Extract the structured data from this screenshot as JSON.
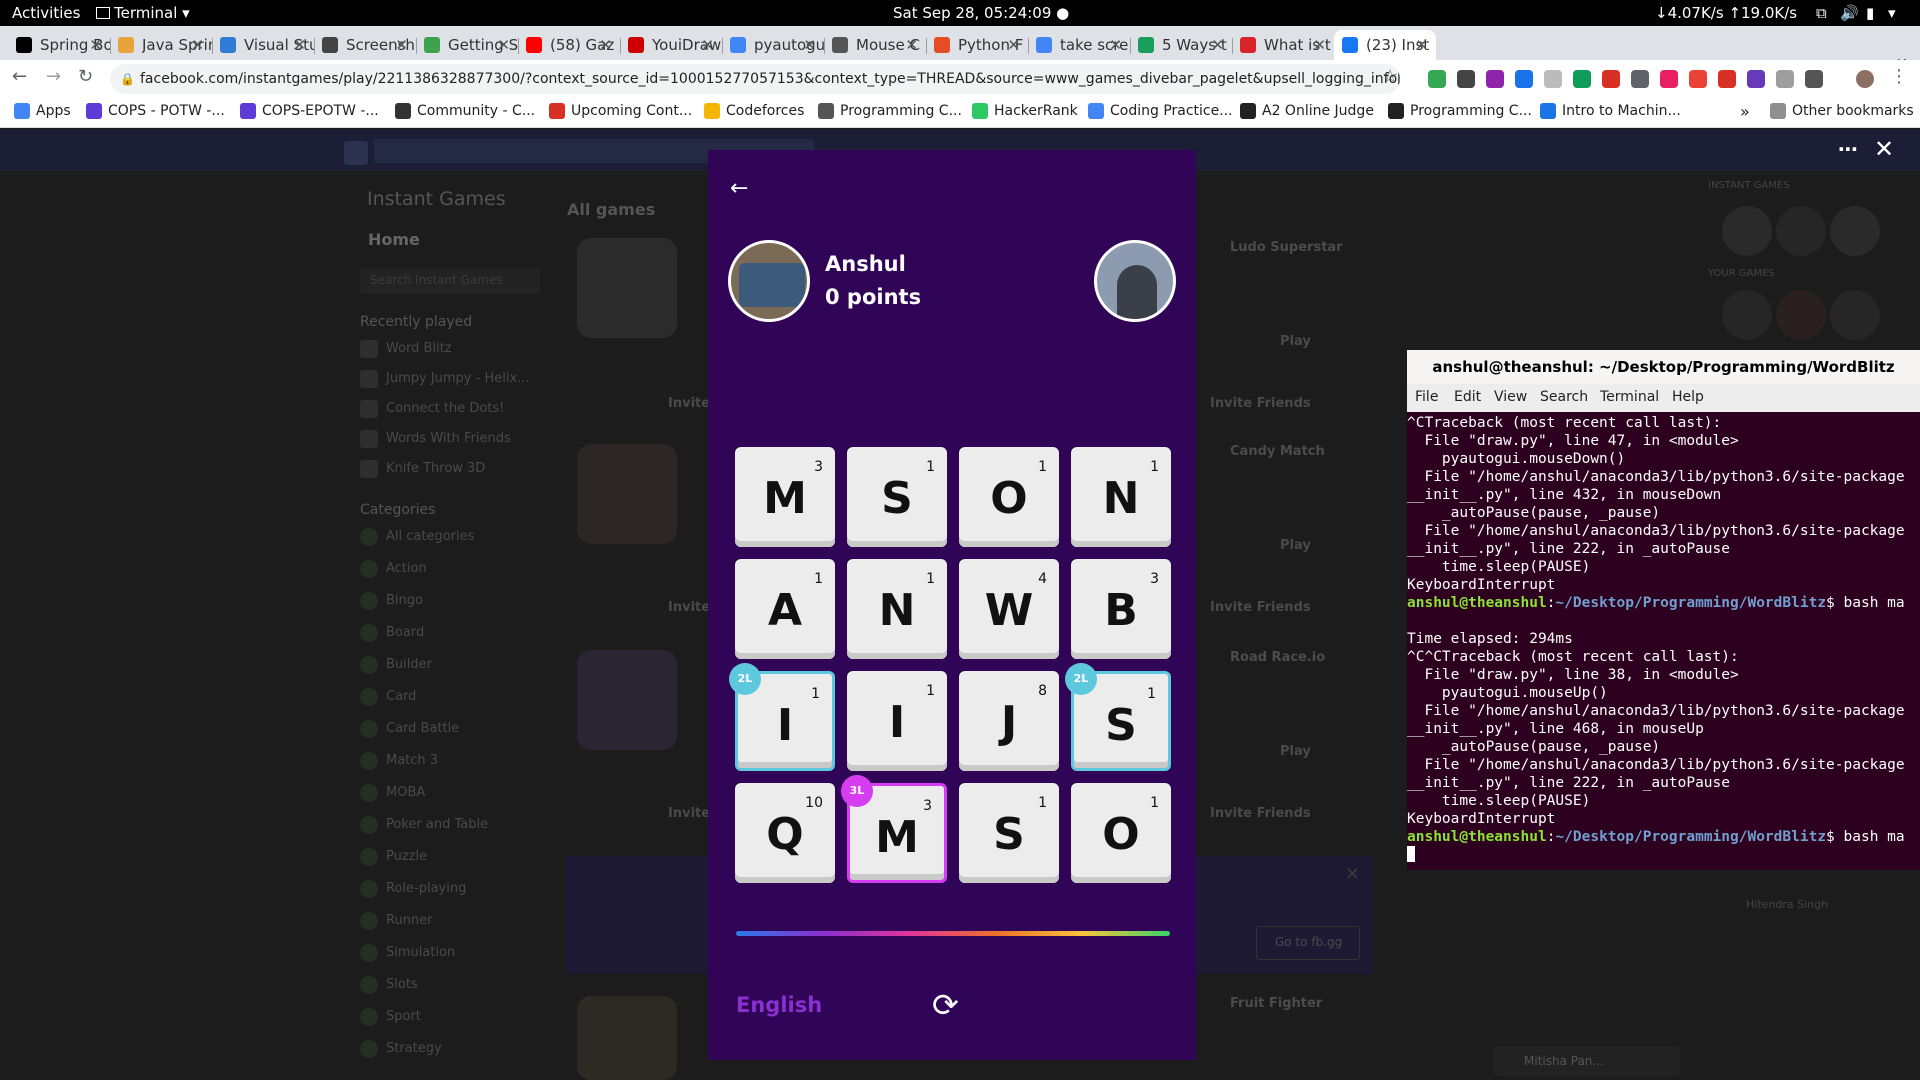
{
  "topbar": {
    "activities": "Activities",
    "app_menu": "Terminal",
    "clock": "Sat Sep 28, 05:24:09",
    "net_speed": "↓4.07K/s ↑19.0K/s"
  },
  "tabs": [
    {
      "label": "Spring Bo",
      "color": "#000000"
    },
    {
      "label": "Java Sprin",
      "color": "#e8a33c"
    },
    {
      "label": "Visual Stu",
      "color": "#2f7bd8"
    },
    {
      "label": "Screensh",
      "color": "#444444"
    },
    {
      "label": "Getting S",
      "color": "#3fa34d"
    },
    {
      "label": "(58) Gaz",
      "color": "#ff0000"
    },
    {
      "label": "YouiDraw",
      "color": "#cc0000"
    },
    {
      "label": "pyautogu",
      "color": "#4285f4"
    },
    {
      "label": "Mouse C",
      "color": "#555555"
    },
    {
      "label": "Python F",
      "color": "#e44d26"
    },
    {
      "label": "take scre",
      "color": "#4285f4"
    },
    {
      "label": "5 Ways t",
      "color": "#1a9e5c"
    },
    {
      "label": "What is t",
      "color": "#d8232a"
    },
    {
      "label": "(23) Inst",
      "color": "#1877f2"
    }
  ],
  "toolbar": {
    "url": "facebook.com/instantgames/play/2211386328877300/?context_source_id=100015277057153&context_type=THREAD&source=www_games_divebar_pagelet&upsell_logging_info[upsell_type]=..."
  },
  "bookmarks": [
    {
      "label": "Apps",
      "color": "#4285f4"
    },
    {
      "label": "COPS - POTW -...",
      "color": "#5c3bd6"
    },
    {
      "label": "COPS-EPOTW -...",
      "color": "#5c3bd6"
    },
    {
      "label": "Community - C...",
      "color": "#333333"
    },
    {
      "label": "Upcoming Cont...",
      "color": "#d93025"
    },
    {
      "label": "Codeforces",
      "color": "#f4b400"
    },
    {
      "label": "Programming C...",
      "color": "#555555"
    },
    {
      "label": "HackerRank",
      "color": "#2ec866"
    },
    {
      "label": "Coding Practice...",
      "color": "#4285f4"
    },
    {
      "label": "A2 Online Judge",
      "color": "#222222"
    },
    {
      "label": "Programming C...",
      "color": "#222222"
    },
    {
      "label": "Intro to Machin...",
      "color": "#1a73e8"
    }
  ],
  "other_bookmarks": "Other bookmarks",
  "fb_background": {
    "section_title": "Instant Games",
    "home": "Home",
    "search_placeholder": "Search Instant Games",
    "recently_played_title": "Recently played",
    "recently_played": [
      "Word Blitz",
      "Jumpy Jumpy - Helix...",
      "Connect the Dots!",
      "Words With Friends",
      "Knife Throw 3D"
    ],
    "categories_title": "Categories",
    "categories": [
      "All categories",
      "Action",
      "Bingo",
      "Board",
      "Builder",
      "Card",
      "Card Battle",
      "Match 3",
      "MOBA",
      "Poker and Table",
      "Puzzle",
      "Role-playing",
      "Runner",
      "Simulation",
      "Slots",
      "Sport",
      "Strategy"
    ],
    "all_games": "All games",
    "right_games": [
      "Ludo Superstar",
      "Candy Match",
      "Road Race.io",
      "Fruit Fighter"
    ],
    "play_label": "Play",
    "invite_label": "Invite Friends",
    "go_to_fbgg": "Go to fb.gg",
    "right_rail": [
      "INSTANT GAMES",
      "YOUR GAMES"
    ],
    "contacts": [
      "Hitendra Singh",
      "Mitisha Pan..."
    ]
  },
  "game": {
    "player_name": "Anshul",
    "player_points": "0 points",
    "language": "English",
    "tiles": [
      {
        "letter": "M",
        "score": "3",
        "bonus": ""
      },
      {
        "letter": "S",
        "score": "1",
        "bonus": ""
      },
      {
        "letter": "O",
        "score": "1",
        "bonus": ""
      },
      {
        "letter": "N",
        "score": "1",
        "bonus": ""
      },
      {
        "letter": "A",
        "score": "1",
        "bonus": ""
      },
      {
        "letter": "N",
        "score": "1",
        "bonus": ""
      },
      {
        "letter": "W",
        "score": "4",
        "bonus": ""
      },
      {
        "letter": "B",
        "score": "3",
        "bonus": ""
      },
      {
        "letter": "I",
        "score": "1",
        "bonus": "2L"
      },
      {
        "letter": "I",
        "score": "1",
        "bonus": ""
      },
      {
        "letter": "J",
        "score": "8",
        "bonus": ""
      },
      {
        "letter": "S",
        "score": "1",
        "bonus": "2L"
      },
      {
        "letter": "Q",
        "score": "10",
        "bonus": ""
      },
      {
        "letter": "M",
        "score": "3",
        "bonus": "3L"
      },
      {
        "letter": "S",
        "score": "1",
        "bonus": ""
      },
      {
        "letter": "O",
        "score": "1",
        "bonus": ""
      }
    ]
  },
  "terminal": {
    "title": "anshul@theanshul: ~/Desktop/Programming/WordBlitz",
    "menu": [
      "File",
      "Edit",
      "View",
      "Search",
      "Terminal",
      "Help"
    ],
    "prompt_user": "anshul@theanshul",
    "prompt_path": "~/Desktop/Programming/WordBlitz",
    "command": "bash ma",
    "block1": [
      "^CTraceback (most recent call last):",
      "  File \"draw.py\", line 47, in <module>",
      "    pyautogui.mouseDown()",
      "  File \"/home/anshul/anaconda3/lib/python3.6/site-package",
      "__init__.py\", line 432, in mouseDown",
      "    _autoPause(pause, _pause)",
      "  File \"/home/anshul/anaconda3/lib/python3.6/site-package",
      "__init__.py\", line 222, in _autoPause",
      "    time.sleep(PAUSE)",
      "KeyboardInterrupt"
    ],
    "elapsed": "Time elapsed: 294ms",
    "block2": [
      "^C^CTraceback (most recent call last):",
      "  File \"draw.py\", line 38, in <module>",
      "    pyautogui.mouseUp()",
      "  File \"/home/anshul/anaconda3/lib/python3.6/site-package",
      "__init__.py\", line 468, in mouseUp",
      "    _autoPause(pause, _pause)",
      "  File \"/home/anshul/anaconda3/lib/python3.6/site-package",
      "__init__.py\", line 222, in _autoPause",
      "    time.sleep(PAUSE)",
      "KeyboardInterrupt"
    ]
  },
  "colors": {
    "game_bg": "#300557",
    "double_letter": "#5ec8dc",
    "triple_letter": "#d63cf0",
    "language": "#8a2fd0"
  }
}
